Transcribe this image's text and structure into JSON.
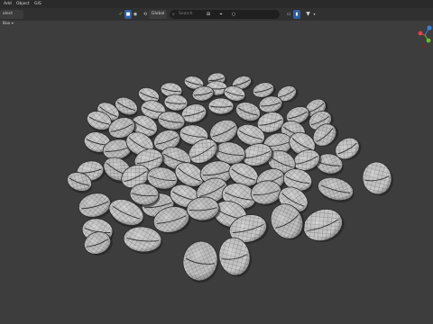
{
  "menu": {
    "items": [
      "Add",
      "Object",
      "GIS"
    ]
  },
  "toolbar": {
    "select_mode": "elect Box",
    "transform_orientation": "Global",
    "search_placeholder": "Search"
  },
  "colors": {
    "background": "#3d3d3d",
    "header": "#2a2a2a",
    "toolbar": "#303030",
    "seed_fill": "#c9c9c9",
    "seed_wire": "#5a5a5a",
    "axis_x": "#e0424a",
    "axis_y": "#6bb82e",
    "axis_z": "#3c7ddc"
  },
  "icons": [
    "checkbox-on-icon",
    "camera-icon",
    "eye-icon",
    "search-icon",
    "transform-pivot-icon",
    "snap-icon",
    "filter-icon",
    "navigation-gizmo"
  ],
  "viewport": {
    "object": "pile of seed meshes (wireframe overlay)"
  }
}
